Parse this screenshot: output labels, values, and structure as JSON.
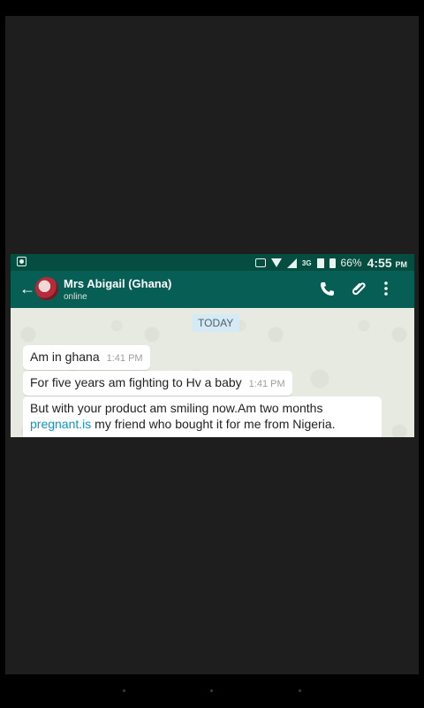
{
  "status_bar": {
    "network": "3G",
    "battery": "66%",
    "time": "4:55",
    "ampm": "PM"
  },
  "header": {
    "back_icon": "arrow-left-icon",
    "contact_name": "Mrs Abigail (Ghana)",
    "contact_status": "online",
    "actions": [
      "phone-icon",
      "paperclip-icon",
      "more-vertical-icon"
    ]
  },
  "chat": {
    "date_label": "TODAY",
    "messages": [
      {
        "text": "Am in ghana",
        "time": "1:41 PM"
      },
      {
        "text": "For five years am fighting to Hv a baby",
        "time": "1:41 PM"
      },
      {
        "line1": "But with your product am smiling now.Am two months",
        "link": "pregnant.is",
        "line2_rest": " my friend  who bought it for me from Nigeria."
      }
    ]
  },
  "colors": {
    "status_bar": "#054c41",
    "app_bar": "#075e54",
    "link": "#0b96c7",
    "date_chip": "#d4eaf4"
  }
}
